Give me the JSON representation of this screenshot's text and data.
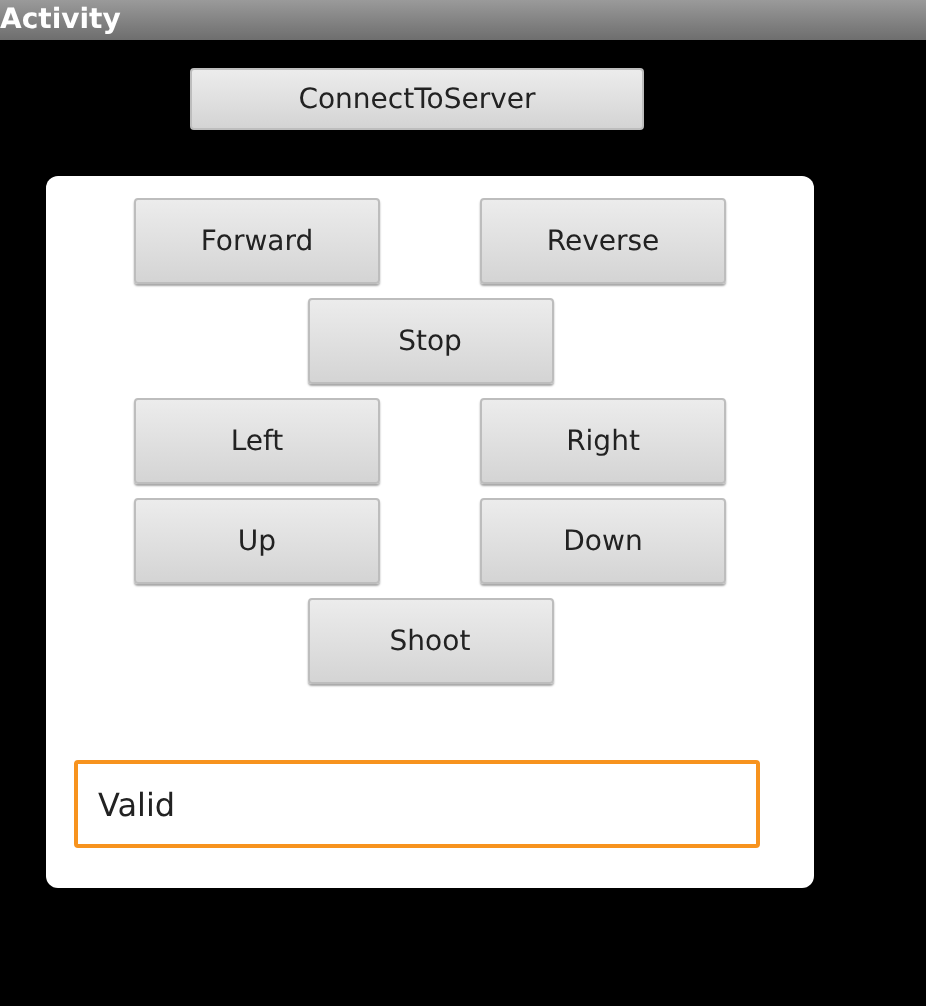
{
  "window": {
    "title": "Activity"
  },
  "connect_button": {
    "label": "ConnectToServer"
  },
  "control_rows": [
    {
      "buttons": [
        {
          "label": "Forward"
        },
        {
          "label": "Reverse"
        }
      ]
    },
    {
      "buttons": [
        {
          "label": "Stop"
        }
      ]
    },
    {
      "buttons": [
        {
          "label": "Left"
        },
        {
          "label": "Right"
        }
      ]
    },
    {
      "buttons": [
        {
          "label": "Up"
        },
        {
          "label": "Down"
        }
      ]
    },
    {
      "buttons": [
        {
          "label": "Shoot"
        }
      ]
    }
  ],
  "input": {
    "value": "Valid",
    "focused": true
  }
}
